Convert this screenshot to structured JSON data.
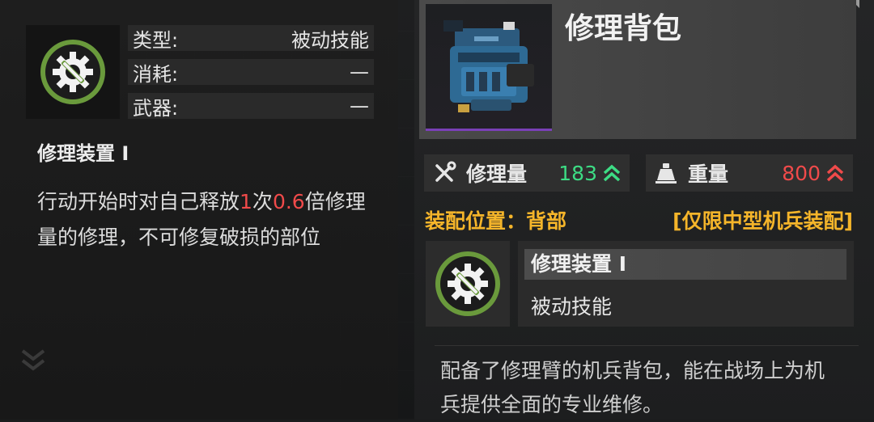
{
  "skill_panel": {
    "stats": [
      {
        "label": "类型:",
        "value": "被动技能"
      },
      {
        "label": "消耗:",
        "value": "—"
      },
      {
        "label": "武器:",
        "value": "—"
      }
    ],
    "skill_name": "修理装置 Ⅰ",
    "description": {
      "part1": "行动开始时对自己释放",
      "count": "1",
      "part2": "次",
      "multiplier": "0.6",
      "part3": "倍修理量的修理，不可修复破损的部位"
    }
  },
  "item_panel": {
    "name": "修理背包",
    "repair": {
      "label": "修理量",
      "value": "183",
      "icon": "wrench-screwdriver-icon"
    },
    "weight": {
      "label": "重量",
      "value": "800",
      "icon": "weight-icon"
    },
    "equip_position": "装配位置：背部",
    "equip_limit": "[仅限中型机兵装配]",
    "skill_card": {
      "title": "修理装置 Ⅰ",
      "type": "被动技能"
    },
    "description": "配备了修理臂的机兵背包，能在战场上为机兵提供全面的专业维修。"
  },
  "colors": {
    "accent_gold": "#f5b52a",
    "positive_green": "#3ddc84",
    "negative_red": "#f04a4a",
    "rarity_purple": "#7a40b8",
    "skill_icon_green": "#6a9a3c"
  }
}
